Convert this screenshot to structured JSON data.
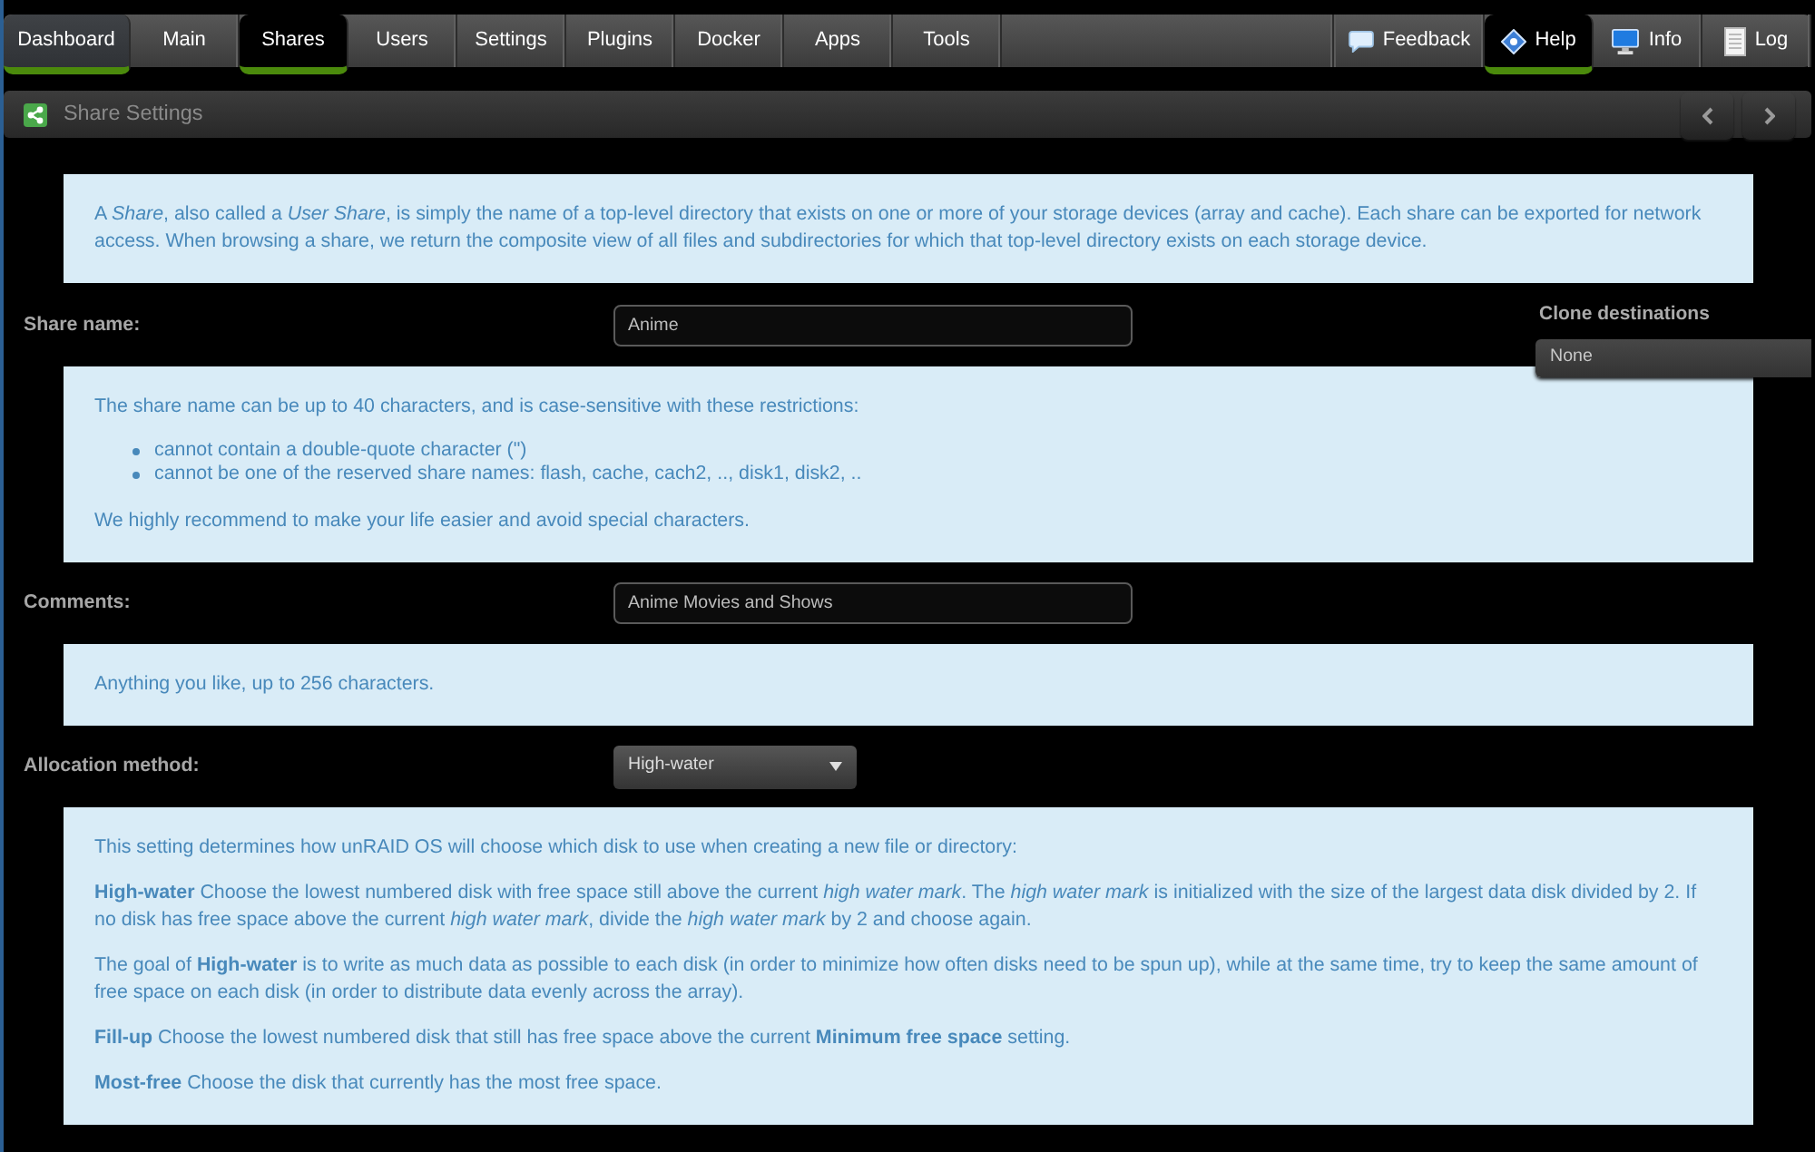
{
  "nav": {
    "tabs": [
      {
        "label": "Dashboard",
        "selected": false,
        "hovered": true
      },
      {
        "label": "Main",
        "selected": false,
        "hovered": false
      },
      {
        "label": "Shares",
        "selected": true,
        "hovered": false
      },
      {
        "label": "Users",
        "selected": false,
        "hovered": false
      },
      {
        "label": "Settings",
        "selected": false,
        "hovered": false
      },
      {
        "label": "Plugins",
        "selected": false,
        "hovered": false
      },
      {
        "label": "Docker",
        "selected": false,
        "hovered": false
      },
      {
        "label": "Apps",
        "selected": false,
        "hovered": false
      },
      {
        "label": "Tools",
        "selected": false,
        "hovered": false
      }
    ],
    "actions": [
      {
        "kind": "feedback",
        "label": "Feedback",
        "selected": false
      },
      {
        "kind": "help",
        "label": "Help",
        "selected": true
      },
      {
        "kind": "info",
        "label": "Info",
        "selected": false
      },
      {
        "kind": "log",
        "label": "Log",
        "selected": false
      }
    ]
  },
  "header": {
    "title": "Share Settings"
  },
  "form": [
    {
      "kind": "help",
      "blocks": [
        {
          "kind": "paragraph",
          "text": "A *Share*, also called a *User Share*, is simply the name of a top-level directory that exists on one or more of your storage devices (array and cache). Each share can be exported for network access. When browsing a share, we return the composite view of all files and subdirectories for which that top-level directory exists on each storage device."
        }
      ]
    },
    {
      "kind": "text",
      "label": "Share name:",
      "value": "Anime",
      "aside": {
        "label": "Clone destinations",
        "value": "None"
      }
    },
    {
      "kind": "help",
      "blocks": [
        {
          "kind": "paragraph",
          "text": "The share name can be up to 40 characters, and is case-sensitive with these restrictions:"
        },
        {
          "kind": "list",
          "items": [
            "cannot contain a double-quote character (\")",
            "cannot be one of the reserved share names: flash, cache, cach2, .., disk1, disk2, .."
          ]
        },
        {
          "kind": "paragraph",
          "text": "We highly recommend to make your life easier and avoid special characters."
        }
      ]
    },
    {
      "kind": "text",
      "label": "Comments:",
      "value": "Anime Movies and Shows"
    },
    {
      "kind": "help",
      "blocks": [
        {
          "kind": "paragraph",
          "text": "Anything you like, up to 256 characters."
        }
      ]
    },
    {
      "kind": "select",
      "label": "Allocation method:",
      "value": "High-water"
    },
    {
      "kind": "help",
      "blocks": [
        {
          "kind": "paragraph",
          "text": "This setting determines how unRAID OS will choose which disk to use when creating a new file or directory:"
        },
        {
          "kind": "paragraph",
          "text": "**High-water** Choose the lowest numbered disk with free space still above the current *high water mark*. The *high water mark* is initialized with the size of the largest data disk divided by 2. If no disk has free space above the current *high water mark*, divide the *high water mark* by 2 and choose again."
        },
        {
          "kind": "paragraph",
          "text": "The goal of **High-water** is to write as much data as possible to each disk (in order to minimize how often disks need to be spun up), while at the same time, try to keep the same amount of free space on each disk (in order to distribute data evenly across the array)."
        },
        {
          "kind": "paragraph",
          "text": "**Fill-up** Choose the lowest numbered disk that still has free space above the current **Minimum free space** setting."
        },
        {
          "kind": "paragraph",
          "text": "**Most-free** Choose the disk that currently has the most free space."
        }
      ]
    }
  ]
}
